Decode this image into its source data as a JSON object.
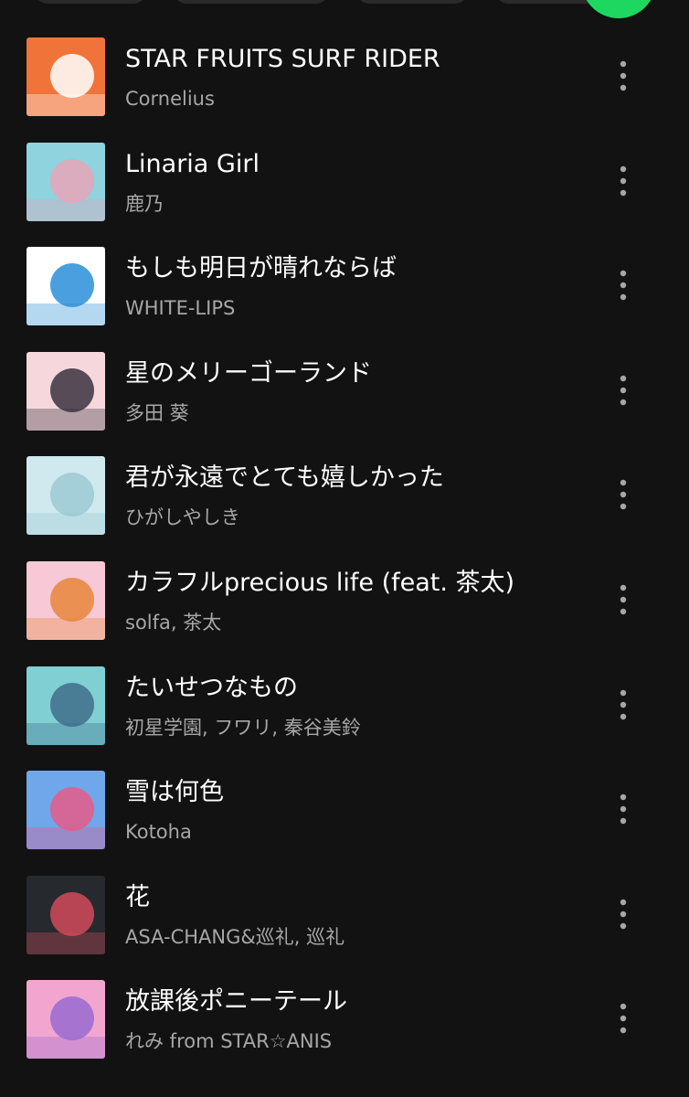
{
  "colors": {
    "background": "#121212",
    "text_primary": "#ffffff",
    "text_secondary": "#a7a7a7",
    "accent": "#1ed760"
  },
  "tracks": [
    {
      "title": "STAR FRUITS SURF RIDER",
      "artist": "Cornelius",
      "cover_icon": "album-art-icon",
      "cover_colors": [
        "#f0743a",
        "#ffffff"
      ]
    },
    {
      "title": "Linaria Girl",
      "artist": "鹿乃",
      "cover_icon": "album-art-icon",
      "cover_colors": [
        "#8fd3df",
        "#e9a3b8"
      ]
    },
    {
      "title": "もしも明日が晴れならば",
      "artist": "WHITE-LIPS",
      "cover_icon": "album-art-icon",
      "cover_colors": [
        "#ffffff",
        "#2a8fd8"
      ]
    },
    {
      "title": "星のメリーゴーランド",
      "artist": "多田 葵",
      "cover_icon": "album-art-icon",
      "cover_colors": [
        "#f6d8dc",
        "#3a3340"
      ]
    },
    {
      "title": "君が永遠でとても嬉しかった",
      "artist": "ひがしやしき",
      "cover_icon": "album-art-icon",
      "cover_colors": [
        "#cfe9ee",
        "#9cc9d3"
      ]
    },
    {
      "title": "カラフルprecious life (feat. 茶太)",
      "artist": "solfa, 茶太",
      "cover_icon": "album-art-icon",
      "cover_colors": [
        "#f7c9d6",
        "#e8863c"
      ]
    },
    {
      "title": "たいせつなもの",
      "artist": "初星学園, フワリ, 秦谷美鈴",
      "cover_icon": "album-art-icon",
      "cover_colors": [
        "#7fcfd3",
        "#3f6d8a"
      ]
    },
    {
      "title": "雪は何色",
      "artist": "Kotoha",
      "cover_icon": "album-art-icon",
      "cover_colors": [
        "#6fa7ea",
        "#e85a8a"
      ]
    },
    {
      "title": "花",
      "artist": "ASA-CHANG&巡礼, 巡礼",
      "cover_icon": "album-art-icon",
      "cover_colors": [
        "#262a2e",
        "#d24a5a"
      ]
    },
    {
      "title": "放課後ポニーテール",
      "artist": "れみ from STAR☆ANIS",
      "cover_icon": "album-art-icon",
      "cover_colors": [
        "#f2a6cf",
        "#9a6ad0"
      ]
    }
  ],
  "more_icon": "more-vertical-icon"
}
